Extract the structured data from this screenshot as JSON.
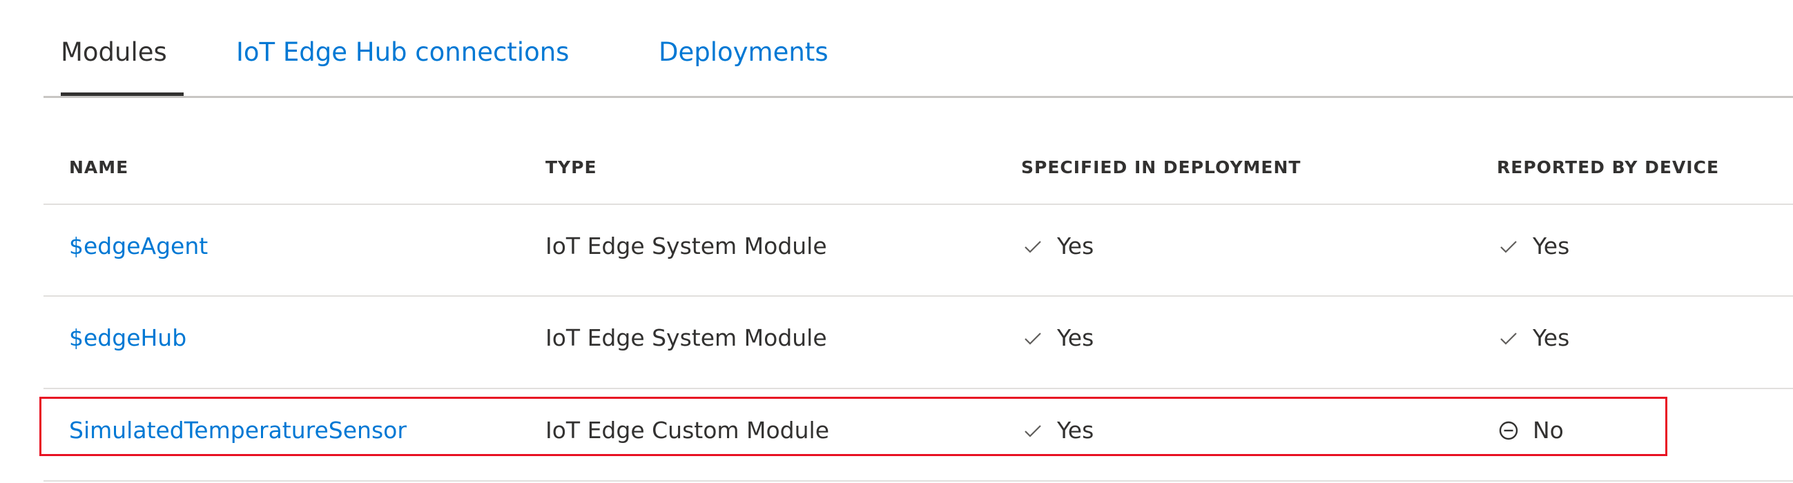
{
  "tabs": [
    {
      "label": "Modules",
      "active": true
    },
    {
      "label": "IoT Edge Hub connections",
      "active": false
    },
    {
      "label": "Deployments",
      "active": false
    }
  ],
  "table": {
    "columns": [
      "NAME",
      "TYPE",
      "SPECIFIED IN DEPLOYMENT",
      "REPORTED BY DEVICE"
    ],
    "rows": [
      {
        "name": "$edgeAgent",
        "type": "IoT Edge System Module",
        "specified": "Yes",
        "specified_icon": "checkmark-icon",
        "reported": "Yes",
        "reported_icon": "checkmark-icon"
      },
      {
        "name": "$edgeHub",
        "type": "IoT Edge System Module",
        "specified": "Yes",
        "specified_icon": "checkmark-icon",
        "reported": "Yes",
        "reported_icon": "checkmark-icon"
      },
      {
        "name": "SimulatedTemperatureSensor",
        "type": "IoT Edge Custom Module",
        "specified": "Yes",
        "specified_icon": "checkmark-icon",
        "reported": "No",
        "reported_icon": "minus-circle-icon",
        "highlighted": true
      }
    ]
  },
  "colors": {
    "link": "#0078d4",
    "text": "#323130",
    "highlight": "#e81123",
    "divider": "#e1dfdd"
  }
}
